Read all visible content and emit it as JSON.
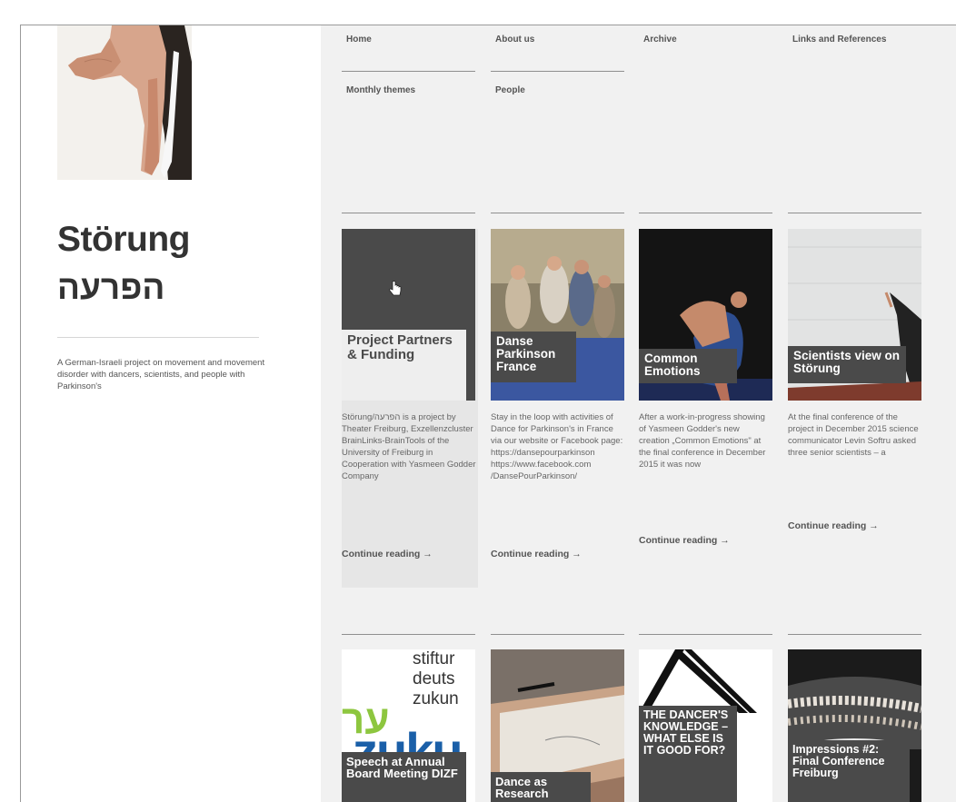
{
  "site": {
    "title": "Störung",
    "title_he": "הפרעה",
    "description": "A German-Israeli project on movement and movement disorder with dancers, scientists, and people with Parkinson's"
  },
  "nav": {
    "home": "Home",
    "about": "About us",
    "archive": "Archive",
    "links": "Links and References",
    "monthly": "Monthly themes",
    "people": "People"
  },
  "posts": [
    {
      "title": "Project Partners & Funding",
      "excerpt": "Störung/הפרעה is a project by Theater Freiburg, Exzellenzcluster BrainLinks-BrainTools of the University of Freiburg in Cooperation with Yasmeen Godder Company",
      "more": "Continue reading →"
    },
    {
      "title": "Danse Parkinson France",
      "excerpt": "Stay in the loop with activities of Dance for Parkinson's in France via our website or Facebook page: https://dansepourparkinson https://www.facebook.com /DansePourParkinson/",
      "more": "Continue reading →"
    },
    {
      "title": "Common Emotions",
      "excerpt": "After a work-in-progress showing of Yasmeen Godder's new creation „Common Emotions\" at the final conference in December 2015 it was now",
      "more": "Continue reading →"
    },
    {
      "title": "Scientists view on Störung",
      "excerpt": "At the final conference of the project in December 2015 science communicator Levin Softru asked three senior scientists – a",
      "more": "Continue reading →"
    }
  ],
  "posts_row2": [
    {
      "title": "Speech at Annual Board Meeting DIZF",
      "logo_lines": [
        "stiftur",
        "deuts",
        "zukun"
      ],
      "logo_he": "ער",
      "logo_big": "zuku"
    },
    {
      "title": "Dance as Research"
    },
    {
      "title": "THE DANCER'S KNOWLEDGE – WHAT ELSE IS IT GOOD FOR?"
    },
    {
      "title": "Impressions #2: Final Conference Freiburg"
    }
  ],
  "colors": {
    "panel": "#f1f1f1",
    "title_box": "#4a4a4a",
    "logo_green": "#8dc63f",
    "logo_blue": "#1a5fa8"
  }
}
